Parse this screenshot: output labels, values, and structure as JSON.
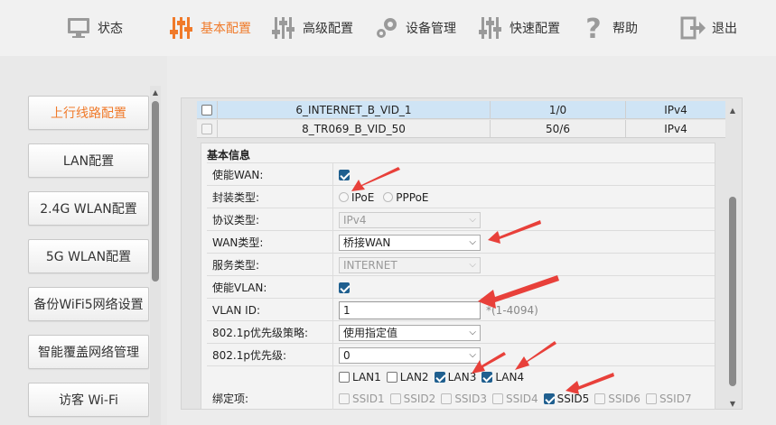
{
  "nav": [
    {
      "label": "状态",
      "icon": "monitor-icon",
      "active": false
    },
    {
      "label": "基本配置",
      "icon": "sliders-icon",
      "active": true
    },
    {
      "label": "高级配置",
      "icon": "sliders-icon",
      "active": false
    },
    {
      "label": "设备管理",
      "icon": "gears-icon",
      "active": false
    },
    {
      "label": "快速配置",
      "icon": "sliders-icon",
      "active": false
    },
    {
      "label": "帮助",
      "icon": "question-icon",
      "active": false
    },
    {
      "label": "退出",
      "icon": "logout-icon",
      "active": false
    }
  ],
  "menu": [
    {
      "label": "上行线路配置",
      "active": true
    },
    {
      "label": "LAN配置",
      "active": false
    },
    {
      "label": "2.4G WLAN配置",
      "active": false
    },
    {
      "label": "5G WLAN配置",
      "active": false
    },
    {
      "label": "备份WiFi5网络设置",
      "active": false
    },
    {
      "label": "智能覆盖网络管理",
      "active": false
    },
    {
      "label": "访客 Wi-Fi",
      "active": false
    }
  ],
  "wan_table": [
    {
      "name": "6_INTERNET_B_VID_1",
      "vlan": "1/0",
      "ip": "IPv4",
      "selected": true
    },
    {
      "name": "8_TR069_B_VID_50",
      "vlan": "50/6",
      "ip": "IPv4",
      "selected": false
    }
  ],
  "form": {
    "section_title": "基本信息",
    "enable_wan_label": "使能WAN:",
    "encap_label": "封装类型:",
    "encap_opt1": "IPoE",
    "encap_opt2": "PPPoE",
    "protocol_label": "协议类型:",
    "protocol_value": "IPv4",
    "wan_type_label": "WAN类型:",
    "wan_type_value": "桥接WAN",
    "service_label": "服务类型:",
    "service_value": "INTERNET",
    "enable_vlan_label": "使能VLAN:",
    "vlan_id_label": "VLAN ID:",
    "vlan_id_value": "1",
    "vlan_id_hint": "*(1-4094)",
    "p8021_policy_label": "802.1p优先级策略:",
    "p8021_policy_value": "使用指定值",
    "p8021_prio_label": "802.1p优先级:",
    "p8021_prio_value": "0",
    "bind_label": "绑定项:",
    "lan_ports": [
      {
        "label": "LAN1",
        "checked": false
      },
      {
        "label": "LAN2",
        "checked": false
      },
      {
        "label": "LAN3",
        "checked": true
      },
      {
        "label": "LAN4",
        "checked": true
      }
    ],
    "ssids": [
      {
        "label": "SSID1",
        "checked": false
      },
      {
        "label": "SSID2",
        "checked": false
      },
      {
        "label": "SSID3",
        "checked": false
      },
      {
        "label": "SSID4",
        "checked": false
      },
      {
        "label": "SSID5",
        "checked": true
      },
      {
        "label": "SSID6",
        "checked": false
      },
      {
        "label": "SSID7",
        "checked": false
      }
    ]
  },
  "colors": {
    "accent": "#f07a2a",
    "annotation_arrow": "#e8403a",
    "selected_row": "#cfe4f5"
  }
}
